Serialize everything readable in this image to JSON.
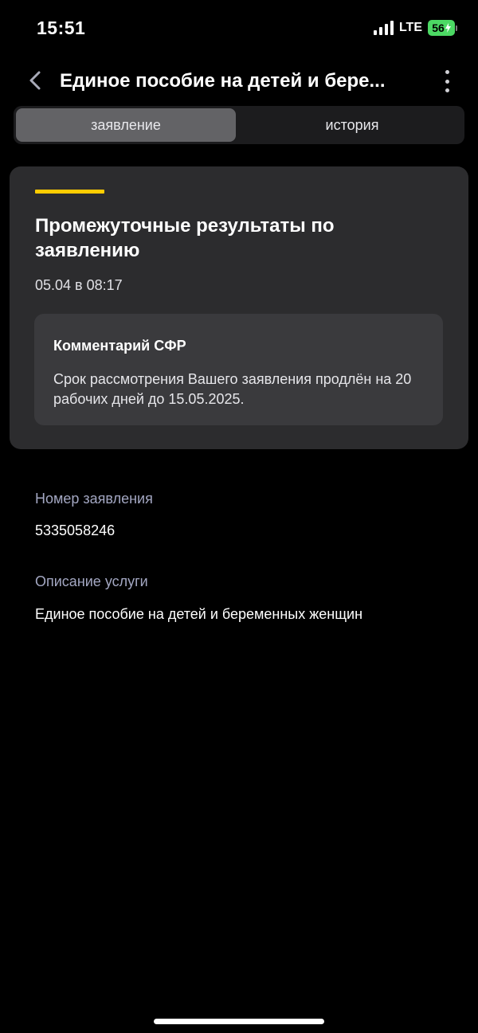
{
  "status_bar": {
    "time": "15:51",
    "network": "LTE",
    "battery": "56"
  },
  "header": {
    "title": "Единое пособие на детей и бере..."
  },
  "tabs": [
    {
      "label": "заявление",
      "active": true
    },
    {
      "label": "история",
      "active": false
    }
  ],
  "card": {
    "accent_color": "#ffcc00",
    "title": "Промежуточные результаты по заявлению",
    "date": "05.04 в 08:17",
    "comment": {
      "title": "Комментарий СФР",
      "text": "Срок рассмотрения Вашего заявления продлён на 20 рабочих дней до 15.05.2025."
    }
  },
  "details": {
    "number_label": "Номер заявления",
    "number_value": "5335058246",
    "service_label": "Описание услуги",
    "service_value": "Единое пособие на детей и беременных женщин"
  }
}
